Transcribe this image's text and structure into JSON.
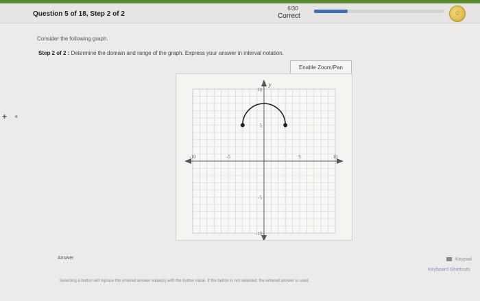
{
  "header": {
    "question": "Question 5 of 18, Step 2 of 2",
    "score": "6/30",
    "status": "Correct",
    "progress_percent": 26,
    "medal_icon": "medal-icon"
  },
  "sidebar": {
    "plus": "+",
    "close": "×"
  },
  "prompt": "Consider the following graph.",
  "step": {
    "label": "Step 2 of 2 :",
    "text": "Determine the domain and range of the graph. Express your answer in interval notation."
  },
  "zoom_button": "Enable Zoom/Pan",
  "chart_data": {
    "type": "line",
    "xlim": [
      -10,
      10
    ],
    "ylim": [
      -10,
      10
    ],
    "grid": true,
    "axis_labels": {
      "y": "y"
    },
    "ticks": {
      "x": [
        "-10",
        "-5",
        "5",
        "10"
      ],
      "y": [
        "10",
        "5",
        "-5",
        "-10"
      ]
    },
    "series": [
      {
        "shape": "semicircle",
        "center": [
          0,
          5
        ],
        "radius": 3,
        "endpoints": [
          [
            -3,
            5
          ],
          [
            3,
            5
          ]
        ],
        "endpoint_style": "closed",
        "color": "#222222"
      }
    ]
  },
  "answer_label": "Answer",
  "keypad": "Keypad",
  "shortcuts": "Keyboard Shortcuts",
  "footer": "Selecting a button will replace the entered answer value(s) with the button value. If the button is not selected, the entered answer is used."
}
